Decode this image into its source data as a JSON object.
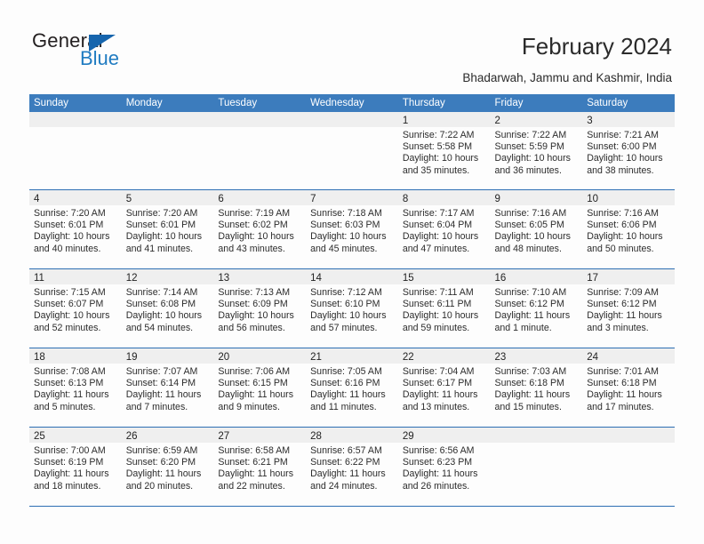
{
  "logo": {
    "word_top": "General",
    "word_bottom": "Blue",
    "triangle_color": "#1665ad",
    "blue_text_color": "#1f7bc1"
  },
  "header": {
    "title": "February 2024",
    "subtitle": "Bhadarwah, Jammu and Kashmir, India"
  },
  "theme": {
    "header_blue": "#3c7cbd",
    "row_separator_blue": "#2d6fb3",
    "date_band_grey": "#efefef",
    "page_background": "#fdfdfd"
  },
  "calendar": {
    "day_names": [
      "Sunday",
      "Monday",
      "Tuesday",
      "Wednesday",
      "Thursday",
      "Friday",
      "Saturday"
    ],
    "labels": {
      "sunrise": "Sunrise:",
      "sunset": "Sunset:",
      "daylight": "Daylight:"
    },
    "weeks": [
      [
        {
          "day": ""
        },
        {
          "day": ""
        },
        {
          "day": ""
        },
        {
          "day": ""
        },
        {
          "day": "1",
          "sunrise": "Sunrise: 7:22 AM",
          "sunset": "Sunset: 5:58 PM",
          "daylight_line1": "Daylight: 10 hours",
          "daylight_line2": "and 35 minutes."
        },
        {
          "day": "2",
          "sunrise": "Sunrise: 7:22 AM",
          "sunset": "Sunset: 5:59 PM",
          "daylight_line1": "Daylight: 10 hours",
          "daylight_line2": "and 36 minutes."
        },
        {
          "day": "3",
          "sunrise": "Sunrise: 7:21 AM",
          "sunset": "Sunset: 6:00 PM",
          "daylight_line1": "Daylight: 10 hours",
          "daylight_line2": "and 38 minutes."
        }
      ],
      [
        {
          "day": "4",
          "sunrise": "Sunrise: 7:20 AM",
          "sunset": "Sunset: 6:01 PM",
          "daylight_line1": "Daylight: 10 hours",
          "daylight_line2": "and 40 minutes."
        },
        {
          "day": "5",
          "sunrise": "Sunrise: 7:20 AM",
          "sunset": "Sunset: 6:01 PM",
          "daylight_line1": "Daylight: 10 hours",
          "daylight_line2": "and 41 minutes."
        },
        {
          "day": "6",
          "sunrise": "Sunrise: 7:19 AM",
          "sunset": "Sunset: 6:02 PM",
          "daylight_line1": "Daylight: 10 hours",
          "daylight_line2": "and 43 minutes."
        },
        {
          "day": "7",
          "sunrise": "Sunrise: 7:18 AM",
          "sunset": "Sunset: 6:03 PM",
          "daylight_line1": "Daylight: 10 hours",
          "daylight_line2": "and 45 minutes."
        },
        {
          "day": "8",
          "sunrise": "Sunrise: 7:17 AM",
          "sunset": "Sunset: 6:04 PM",
          "daylight_line1": "Daylight: 10 hours",
          "daylight_line2": "and 47 minutes."
        },
        {
          "day": "9",
          "sunrise": "Sunrise: 7:16 AM",
          "sunset": "Sunset: 6:05 PM",
          "daylight_line1": "Daylight: 10 hours",
          "daylight_line2": "and 48 minutes."
        },
        {
          "day": "10",
          "sunrise": "Sunrise: 7:16 AM",
          "sunset": "Sunset: 6:06 PM",
          "daylight_line1": "Daylight: 10 hours",
          "daylight_line2": "and 50 minutes."
        }
      ],
      [
        {
          "day": "11",
          "sunrise": "Sunrise: 7:15 AM",
          "sunset": "Sunset: 6:07 PM",
          "daylight_line1": "Daylight: 10 hours",
          "daylight_line2": "and 52 minutes."
        },
        {
          "day": "12",
          "sunrise": "Sunrise: 7:14 AM",
          "sunset": "Sunset: 6:08 PM",
          "daylight_line1": "Daylight: 10 hours",
          "daylight_line2": "and 54 minutes."
        },
        {
          "day": "13",
          "sunrise": "Sunrise: 7:13 AM",
          "sunset": "Sunset: 6:09 PM",
          "daylight_line1": "Daylight: 10 hours",
          "daylight_line2": "and 56 minutes."
        },
        {
          "day": "14",
          "sunrise": "Sunrise: 7:12 AM",
          "sunset": "Sunset: 6:10 PM",
          "daylight_line1": "Daylight: 10 hours",
          "daylight_line2": "and 57 minutes."
        },
        {
          "day": "15",
          "sunrise": "Sunrise: 7:11 AM",
          "sunset": "Sunset: 6:11 PM",
          "daylight_line1": "Daylight: 10 hours",
          "daylight_line2": "and 59 minutes."
        },
        {
          "day": "16",
          "sunrise": "Sunrise: 7:10 AM",
          "sunset": "Sunset: 6:12 PM",
          "daylight_line1": "Daylight: 11 hours",
          "daylight_line2": "and 1 minute."
        },
        {
          "day": "17",
          "sunrise": "Sunrise: 7:09 AM",
          "sunset": "Sunset: 6:12 PM",
          "daylight_line1": "Daylight: 11 hours",
          "daylight_line2": "and 3 minutes."
        }
      ],
      [
        {
          "day": "18",
          "sunrise": "Sunrise: 7:08 AM",
          "sunset": "Sunset: 6:13 PM",
          "daylight_line1": "Daylight: 11 hours",
          "daylight_line2": "and 5 minutes."
        },
        {
          "day": "19",
          "sunrise": "Sunrise: 7:07 AM",
          "sunset": "Sunset: 6:14 PM",
          "daylight_line1": "Daylight: 11 hours",
          "daylight_line2": "and 7 minutes."
        },
        {
          "day": "20",
          "sunrise": "Sunrise: 7:06 AM",
          "sunset": "Sunset: 6:15 PM",
          "daylight_line1": "Daylight: 11 hours",
          "daylight_line2": "and 9 minutes."
        },
        {
          "day": "21",
          "sunrise": "Sunrise: 7:05 AM",
          "sunset": "Sunset: 6:16 PM",
          "daylight_line1": "Daylight: 11 hours",
          "daylight_line2": "and 11 minutes."
        },
        {
          "day": "22",
          "sunrise": "Sunrise: 7:04 AM",
          "sunset": "Sunset: 6:17 PM",
          "daylight_line1": "Daylight: 11 hours",
          "daylight_line2": "and 13 minutes."
        },
        {
          "day": "23",
          "sunrise": "Sunrise: 7:03 AM",
          "sunset": "Sunset: 6:18 PM",
          "daylight_line1": "Daylight: 11 hours",
          "daylight_line2": "and 15 minutes."
        },
        {
          "day": "24",
          "sunrise": "Sunrise: 7:01 AM",
          "sunset": "Sunset: 6:18 PM",
          "daylight_line1": "Daylight: 11 hours",
          "daylight_line2": "and 17 minutes."
        }
      ],
      [
        {
          "day": "25",
          "sunrise": "Sunrise: 7:00 AM",
          "sunset": "Sunset: 6:19 PM",
          "daylight_line1": "Daylight: 11 hours",
          "daylight_line2": "and 18 minutes."
        },
        {
          "day": "26",
          "sunrise": "Sunrise: 6:59 AM",
          "sunset": "Sunset: 6:20 PM",
          "daylight_line1": "Daylight: 11 hours",
          "daylight_line2": "and 20 minutes."
        },
        {
          "day": "27",
          "sunrise": "Sunrise: 6:58 AM",
          "sunset": "Sunset: 6:21 PM",
          "daylight_line1": "Daylight: 11 hours",
          "daylight_line2": "and 22 minutes."
        },
        {
          "day": "28",
          "sunrise": "Sunrise: 6:57 AM",
          "sunset": "Sunset: 6:22 PM",
          "daylight_line1": "Daylight: 11 hours",
          "daylight_line2": "and 24 minutes."
        },
        {
          "day": "29",
          "sunrise": "Sunrise: 6:56 AM",
          "sunset": "Sunset: 6:23 PM",
          "daylight_line1": "Daylight: 11 hours",
          "daylight_line2": "and 26 minutes."
        },
        {
          "day": ""
        },
        {
          "day": ""
        }
      ]
    ]
  }
}
